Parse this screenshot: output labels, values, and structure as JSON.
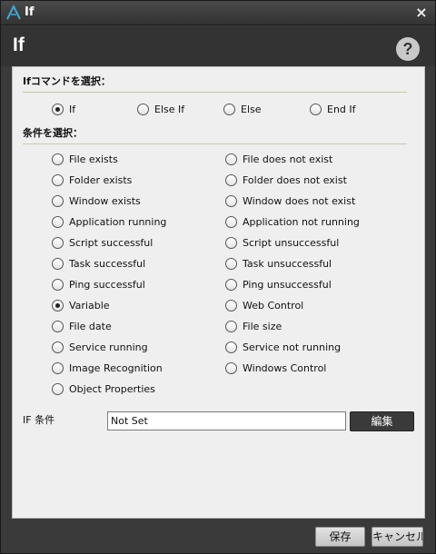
{
  "window": {
    "title": "If",
    "close_glyph": "×",
    "app_icon": "app-logo-icon"
  },
  "header": {
    "title": "If",
    "help_glyph": "?"
  },
  "command_section": {
    "label": "Ifコマンドを選択：",
    "options": [
      {
        "label": "If",
        "checked": true
      },
      {
        "label": "Else If",
        "checked": false
      },
      {
        "label": "Else",
        "checked": false
      },
      {
        "label": "End If",
        "checked": false
      }
    ]
  },
  "condition_section": {
    "label": "条件を選択：",
    "left": [
      {
        "label": "File exists",
        "checked": false
      },
      {
        "label": "Folder exists",
        "checked": false
      },
      {
        "label": "Window exists",
        "checked": false
      },
      {
        "label": "Application running",
        "checked": false
      },
      {
        "label": "Script successful",
        "checked": false
      },
      {
        "label": "Task successful",
        "checked": false
      },
      {
        "label": "Ping successful",
        "checked": false
      },
      {
        "label": "Variable",
        "checked": true
      },
      {
        "label": "File date",
        "checked": false
      },
      {
        "label": "Service running",
        "checked": false
      },
      {
        "label": "Image Recognition",
        "checked": false
      },
      {
        "label": "Object Properties",
        "checked": false
      }
    ],
    "right": [
      {
        "label": "File does not exist",
        "checked": false
      },
      {
        "label": "Folder does not exist",
        "checked": false
      },
      {
        "label": "Window does not exist",
        "checked": false
      },
      {
        "label": "Application not running",
        "checked": false
      },
      {
        "label": "Script unsuccessful",
        "checked": false
      },
      {
        "label": "Task unsuccessful",
        "checked": false
      },
      {
        "label": "Ping unsuccessful",
        "checked": false
      },
      {
        "label": "Web Control",
        "checked": false
      },
      {
        "label": "File size",
        "checked": false
      },
      {
        "label": "Service not running",
        "checked": false
      },
      {
        "label": "Windows Control",
        "checked": false
      }
    ]
  },
  "if_condition": {
    "label": "IF 条件",
    "value": "Not Set",
    "edit_label": "編集"
  },
  "footer": {
    "save_label": "保存",
    "cancel_label": "キャンセル"
  }
}
